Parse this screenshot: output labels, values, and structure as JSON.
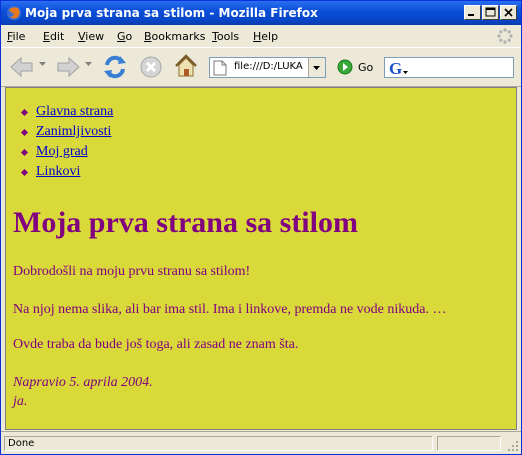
{
  "window": {
    "title": "Moja prva strana sa stilom - Mozilla Firefox"
  },
  "menu": {
    "file": {
      "u": "F",
      "rest": "ile"
    },
    "edit": {
      "u": "E",
      "rest": "dit"
    },
    "view": {
      "u": "V",
      "rest": "iew"
    },
    "go": {
      "u": "G",
      "rest": "o"
    },
    "bookmarks": {
      "u": "B",
      "rest": "ookmarks"
    },
    "tools": {
      "u": "T",
      "rest": "ools"
    },
    "help": {
      "u": "H",
      "rest": "elp"
    }
  },
  "toolbar": {
    "url": "file:///D:/LUKA",
    "go_label": "Go",
    "search_value": ""
  },
  "page": {
    "nav": [
      "Glavna strana",
      "Zanimljivosti",
      "Moj grad",
      "Linkovi"
    ],
    "heading": "Moja prva strana sa stilom",
    "p1": "Dobrodošli na moju prvu stranu sa stilom!",
    "p2": "Na njoj nema slika, ali bar ima stil. Ima i linkove, premda ne vode nikuda. …",
    "p3": "Ovde traba da bude još toga, ali zasad ne znam šta.",
    "signature_line1": "Napravio 5. aprila 2004.",
    "signature_line2": "ja."
  },
  "status": {
    "text": "Done"
  },
  "colors": {
    "page_background": "#d9d93a",
    "text": "#800080",
    "link": "#0000cc"
  }
}
